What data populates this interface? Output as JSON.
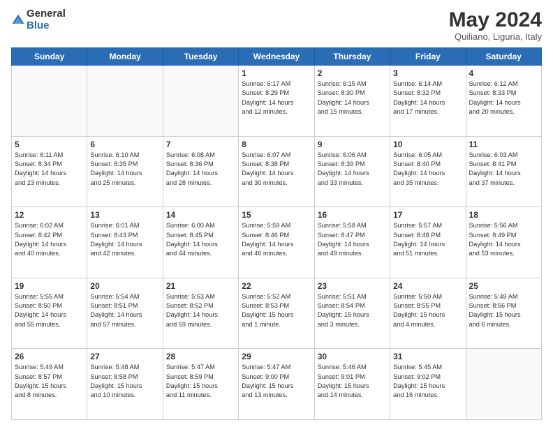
{
  "header": {
    "logo_general": "General",
    "logo_blue": "Blue",
    "month_title": "May 2024",
    "subtitle": "Quiliano, Liguria, Italy"
  },
  "days_of_week": [
    "Sunday",
    "Monday",
    "Tuesday",
    "Wednesday",
    "Thursday",
    "Friday",
    "Saturday"
  ],
  "weeks": [
    [
      {
        "day": "",
        "info": ""
      },
      {
        "day": "",
        "info": ""
      },
      {
        "day": "",
        "info": ""
      },
      {
        "day": "1",
        "info": "Sunrise: 6:17 AM\nSunset: 8:29 PM\nDaylight: 14 hours\nand 12 minutes."
      },
      {
        "day": "2",
        "info": "Sunrise: 6:15 AM\nSunset: 8:30 PM\nDaylight: 14 hours\nand 15 minutes."
      },
      {
        "day": "3",
        "info": "Sunrise: 6:14 AM\nSunset: 8:32 PM\nDaylight: 14 hours\nand 17 minutes."
      },
      {
        "day": "4",
        "info": "Sunrise: 6:12 AM\nSunset: 8:33 PM\nDaylight: 14 hours\nand 20 minutes."
      }
    ],
    [
      {
        "day": "5",
        "info": "Sunrise: 6:11 AM\nSunset: 8:34 PM\nDaylight: 14 hours\nand 23 minutes."
      },
      {
        "day": "6",
        "info": "Sunrise: 6:10 AM\nSunset: 8:35 PM\nDaylight: 14 hours\nand 25 minutes."
      },
      {
        "day": "7",
        "info": "Sunrise: 6:08 AM\nSunset: 8:36 PM\nDaylight: 14 hours\nand 28 minutes."
      },
      {
        "day": "8",
        "info": "Sunrise: 6:07 AM\nSunset: 8:38 PM\nDaylight: 14 hours\nand 30 minutes."
      },
      {
        "day": "9",
        "info": "Sunrise: 6:06 AM\nSunset: 8:39 PM\nDaylight: 14 hours\nand 33 minutes."
      },
      {
        "day": "10",
        "info": "Sunrise: 6:05 AM\nSunset: 8:40 PM\nDaylight: 14 hours\nand 35 minutes."
      },
      {
        "day": "11",
        "info": "Sunrise: 6:03 AM\nSunset: 8:41 PM\nDaylight: 14 hours\nand 37 minutes."
      }
    ],
    [
      {
        "day": "12",
        "info": "Sunrise: 6:02 AM\nSunset: 8:42 PM\nDaylight: 14 hours\nand 40 minutes."
      },
      {
        "day": "13",
        "info": "Sunrise: 6:01 AM\nSunset: 8:43 PM\nDaylight: 14 hours\nand 42 minutes."
      },
      {
        "day": "14",
        "info": "Sunrise: 6:00 AM\nSunset: 8:45 PM\nDaylight: 14 hours\nand 44 minutes."
      },
      {
        "day": "15",
        "info": "Sunrise: 5:59 AM\nSunset: 8:46 PM\nDaylight: 14 hours\nand 46 minutes."
      },
      {
        "day": "16",
        "info": "Sunrise: 5:58 AM\nSunset: 8:47 PM\nDaylight: 14 hours\nand 49 minutes."
      },
      {
        "day": "17",
        "info": "Sunrise: 5:57 AM\nSunset: 8:48 PM\nDaylight: 14 hours\nand 51 minutes."
      },
      {
        "day": "18",
        "info": "Sunrise: 5:56 AM\nSunset: 8:49 PM\nDaylight: 14 hours\nand 53 minutes."
      }
    ],
    [
      {
        "day": "19",
        "info": "Sunrise: 5:55 AM\nSunset: 8:50 PM\nDaylight: 14 hours\nand 55 minutes."
      },
      {
        "day": "20",
        "info": "Sunrise: 5:54 AM\nSunset: 8:51 PM\nDaylight: 14 hours\nand 57 minutes."
      },
      {
        "day": "21",
        "info": "Sunrise: 5:53 AM\nSunset: 8:52 PM\nDaylight: 14 hours\nand 59 minutes."
      },
      {
        "day": "22",
        "info": "Sunrise: 5:52 AM\nSunset: 8:53 PM\nDaylight: 15 hours\nand 1 minute."
      },
      {
        "day": "23",
        "info": "Sunrise: 5:51 AM\nSunset: 8:54 PM\nDaylight: 15 hours\nand 3 minutes."
      },
      {
        "day": "24",
        "info": "Sunrise: 5:50 AM\nSunset: 8:55 PM\nDaylight: 15 hours\nand 4 minutes."
      },
      {
        "day": "25",
        "info": "Sunrise: 5:49 AM\nSunset: 8:56 PM\nDaylight: 15 hours\nand 6 minutes."
      }
    ],
    [
      {
        "day": "26",
        "info": "Sunrise: 5:49 AM\nSunset: 8:57 PM\nDaylight: 15 hours\nand 8 minutes."
      },
      {
        "day": "27",
        "info": "Sunrise: 5:48 AM\nSunset: 8:58 PM\nDaylight: 15 hours\nand 10 minutes."
      },
      {
        "day": "28",
        "info": "Sunrise: 5:47 AM\nSunset: 8:59 PM\nDaylight: 15 hours\nand 11 minutes."
      },
      {
        "day": "29",
        "info": "Sunrise: 5:47 AM\nSunset: 9:00 PM\nDaylight: 15 hours\nand 13 minutes."
      },
      {
        "day": "30",
        "info": "Sunrise: 5:46 AM\nSunset: 9:01 PM\nDaylight: 15 hours\nand 14 minutes."
      },
      {
        "day": "31",
        "info": "Sunrise: 5:45 AM\nSunset: 9:02 PM\nDaylight: 15 hours\nand 16 minutes."
      },
      {
        "day": "",
        "info": ""
      }
    ]
  ]
}
